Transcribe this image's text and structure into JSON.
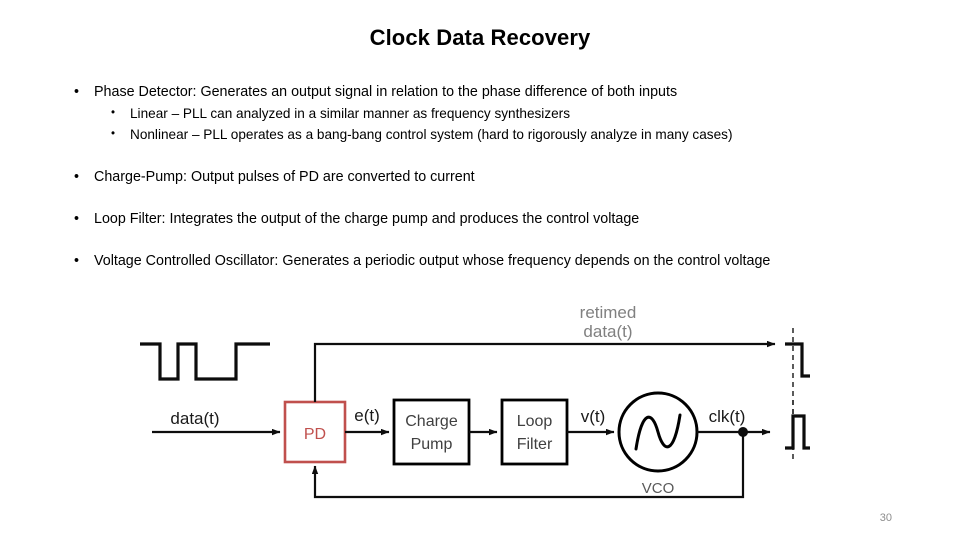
{
  "slide": {
    "title": "Clock Data Recovery",
    "page_number": "30"
  },
  "content": {
    "bullets": [
      {
        "level": 1,
        "marker": "•",
        "text": "Phase Detector: Generates an output signal in relation to the phase difference of both inputs"
      },
      {
        "level": 2,
        "marker": "•",
        "text": "Linear – PLL can analyzed in a similar manner as frequency synthesizers"
      },
      {
        "level": 2,
        "marker": "•",
        "text": "Nonlinear – PLL operates as a bang-bang control system (hard to rigorously analyze in many cases)"
      },
      {
        "level": 1,
        "marker": "•",
        "text": "Charge-Pump: Output pulses of PD are converted to current"
      },
      {
        "level": 1,
        "marker": "•",
        "text": "Loop Filter: Integrates the output of the charge pump and produces the control voltage"
      },
      {
        "level": 1,
        "marker": "•",
        "text": "Voltage Controlled Oscillator: Generates a periodic output whose frequency depends on the  control voltage"
      }
    ]
  },
  "diagram": {
    "title": "clock-data-recovery-block-diagram",
    "colors": {
      "pd_accent": "#c0504d",
      "block_outline": "#000000",
      "block_text": "#404040",
      "signal_text": "#1a1a1a",
      "retimed_label": "#808080",
      "waveform": "#0d0d0d",
      "gridline": "#333333"
    },
    "blocks": [
      {
        "id": "pd",
        "label": "PD",
        "accent": "red"
      },
      {
        "id": "charge_pump",
        "label_line1": "Charge",
        "label_line2": "Pump",
        "accent": "black"
      },
      {
        "id": "loop_filter",
        "label_line1": "Loop",
        "label_line2": "Filter",
        "accent": "black"
      },
      {
        "id": "vco",
        "label": "VCO",
        "shape": "circle-sine"
      }
    ],
    "signals": {
      "input": "data(t)",
      "pd_out": "e(t)",
      "filter_out": "v(t)",
      "vco_out": "clk(t)",
      "retimed_line1": "retimed",
      "retimed_line2": "data(t)"
    },
    "waveforms": {
      "input_data": "irregular NRZ data burst",
      "retimed_data": "retimed NRZ data aligned to clock edges",
      "clock": "periodic square clock"
    }
  }
}
